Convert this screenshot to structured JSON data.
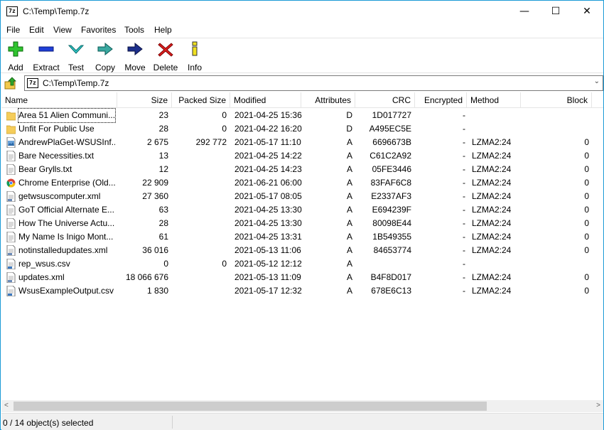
{
  "window": {
    "title": "C:\\Temp\\Temp.7z",
    "app_icon": "7z",
    "minimize": "—",
    "maximize": "☐",
    "close": "✕"
  },
  "menu": [
    "File",
    "Edit",
    "View",
    "Favorites",
    "Tools",
    "Help"
  ],
  "toolbar": {
    "add": "Add",
    "extract": "Extract",
    "test": "Test",
    "copy": "Copy",
    "move": "Move",
    "delete": "Delete",
    "info": "Info"
  },
  "address": {
    "path": "C:\\Temp\\Temp.7z",
    "icon": "7z",
    "dropdown": "⌄"
  },
  "columns": {
    "name": "Name",
    "size": "Size",
    "packed": "Packed Size",
    "modified": "Modified",
    "attributes": "Attributes",
    "crc": "CRC",
    "encrypted": "Encrypted",
    "method": "Method",
    "block": "Block"
  },
  "rows": [
    {
      "name": "Area 51 Alien Communi...",
      "size": "23",
      "packed": "0",
      "modified": "2021-04-25 15:36",
      "attr": "D",
      "crc": "1D017727",
      "enc": "-",
      "method": "",
      "block": "",
      "icon": "folder"
    },
    {
      "name": "Unfit For Public Use",
      "size": "28",
      "packed": "0",
      "modified": "2021-04-22 16:20",
      "attr": "D",
      "crc": "A495EC5E",
      "enc": "-",
      "method": "",
      "block": "",
      "icon": "folder"
    },
    {
      "name": "AndrewPlaGet-WSUSInf...",
      "size": "2 675",
      "packed": "292 772",
      "modified": "2021-05-17 11:10",
      "attr": "A",
      "crc": "6696673B",
      "enc": "-",
      "method": "LZMA2:24",
      "block": "0",
      "icon": "image-file"
    },
    {
      "name": "Bare Necessities.txt",
      "size": "13",
      "packed": "",
      "modified": "2021-04-25 14:22",
      "attr": "A",
      "crc": "C61C2A92",
      "enc": "-",
      "method": "LZMA2:24",
      "block": "0",
      "icon": "text-file"
    },
    {
      "name": "Bear Grylls.txt",
      "size": "12",
      "packed": "",
      "modified": "2021-04-25 14:23",
      "attr": "A",
      "crc": "05FE3446",
      "enc": "-",
      "method": "LZMA2:24",
      "block": "0",
      "icon": "text-file"
    },
    {
      "name": "Chrome Enterprise (Old...",
      "size": "22 909",
      "packed": "",
      "modified": "2021-06-21 06:00",
      "attr": "A",
      "crc": "83FAF6C8",
      "enc": "-",
      "method": "LZMA2:24",
      "block": "0",
      "icon": "chrome-file"
    },
    {
      "name": "getwsuscomputer.xml",
      "size": "27 360",
      "packed": "",
      "modified": "2021-05-17 08:05",
      "attr": "A",
      "crc": "E2337AF3",
      "enc": "-",
      "method": "LZMA2:24",
      "block": "0",
      "icon": "xml-file"
    },
    {
      "name": "GoT Official Alternate E...",
      "size": "63",
      "packed": "",
      "modified": "2021-04-25 13:30",
      "attr": "A",
      "crc": "E694239F",
      "enc": "-",
      "method": "LZMA2:24",
      "block": "0",
      "icon": "text-file"
    },
    {
      "name": "How The Universe Actu...",
      "size": "28",
      "packed": "",
      "modified": "2021-04-25 13:30",
      "attr": "A",
      "crc": "80098E44",
      "enc": "-",
      "method": "LZMA2:24",
      "block": "0",
      "icon": "text-file"
    },
    {
      "name": "My Name Is Inigo Mont...",
      "size": "61",
      "packed": "",
      "modified": "2021-04-25 13:31",
      "attr": "A",
      "crc": "1B549355",
      "enc": "-",
      "method": "LZMA2:24",
      "block": "0",
      "icon": "text-file"
    },
    {
      "name": "notinstalledupdates.xml",
      "size": "36 016",
      "packed": "",
      "modified": "2021-05-13 11:06",
      "attr": "A",
      "crc": "84653774",
      "enc": "-",
      "method": "LZMA2:24",
      "block": "0",
      "icon": "xml-file"
    },
    {
      "name": "rep_wsus.csv",
      "size": "0",
      "packed": "0",
      "modified": "2021-05-12 12:12",
      "attr": "A",
      "crc": "",
      "enc": "-",
      "method": "",
      "block": "",
      "icon": "csv-file"
    },
    {
      "name": "updates.xml",
      "size": "18 066 676",
      "packed": "",
      "modified": "2021-05-13 11:09",
      "attr": "A",
      "crc": "B4F8D017",
      "enc": "-",
      "method": "LZMA2:24",
      "block": "0",
      "icon": "xml-file"
    },
    {
      "name": "WsusExampleOutput.csv",
      "size": "1 830",
      "packed": "",
      "modified": "2021-05-17 12:32",
      "attr": "A",
      "crc": "678E6C13",
      "enc": "-",
      "method": "LZMA2:24",
      "block": "0",
      "icon": "csv-file"
    }
  ],
  "scroll": {
    "left": "<",
    "right": ">"
  },
  "status": {
    "text": "0 / 14 object(s) selected"
  }
}
